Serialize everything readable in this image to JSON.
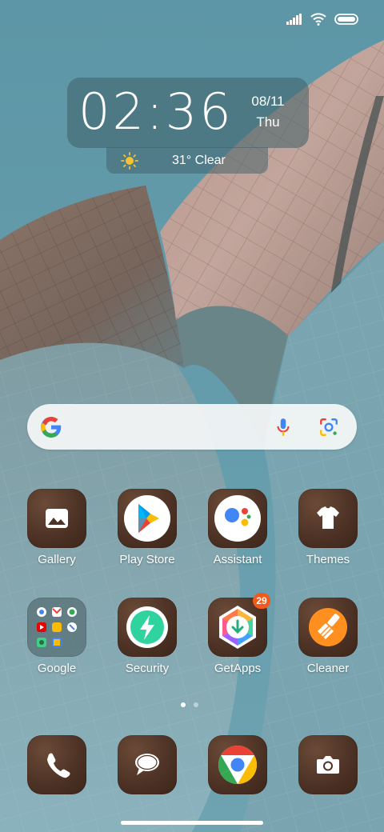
{
  "status_bar": {
    "signal": "signal-icon",
    "wifi": "wifi-icon",
    "battery": "battery-icon"
  },
  "clock_widget": {
    "time": "02:36",
    "date": "08/11",
    "day": "Thu"
  },
  "weather_widget": {
    "icon": "sun-icon",
    "text": "31° Clear"
  },
  "search_bar": {
    "logo": "google-g-icon",
    "mic": "mic-icon",
    "lens": "lens-icon"
  },
  "apps": [
    {
      "label": "Gallery",
      "icon": "gallery-icon"
    },
    {
      "label": "Play Store",
      "icon": "play-store-icon"
    },
    {
      "label": "Assistant",
      "icon": "assistant-icon"
    },
    {
      "label": "Themes",
      "icon": "themes-icon"
    },
    {
      "label": "Google",
      "icon": "google-folder-icon"
    },
    {
      "label": "Security",
      "icon": "security-icon"
    },
    {
      "label": "GetApps",
      "icon": "getapps-icon",
      "badge": "29"
    },
    {
      "label": "Cleaner",
      "icon": "cleaner-icon"
    }
  ],
  "page_indicator": {
    "pages": 2,
    "active": 1
  },
  "dock": [
    {
      "icon": "phone-icon"
    },
    {
      "icon": "messages-icon"
    },
    {
      "icon": "chrome-icon"
    },
    {
      "icon": "camera-icon"
    }
  ],
  "colors": {
    "sky": "#5f97a7",
    "tile_brown": "#4e3326",
    "badge": "#f25a1d",
    "search_bg": "#f5f7f8"
  }
}
